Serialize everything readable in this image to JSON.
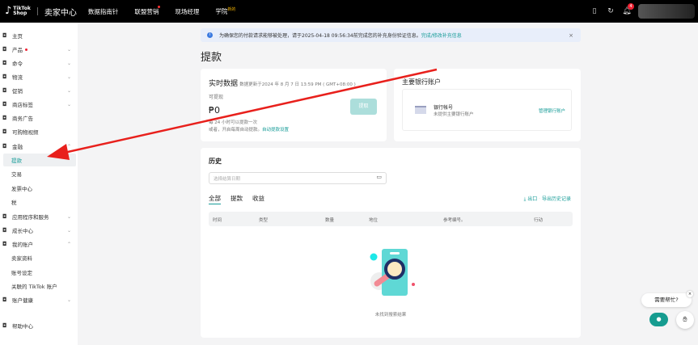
{
  "topbar": {
    "logo_line1": "TikTok",
    "logo_line2": "Shop",
    "brand": "卖家中心",
    "nav": [
      "数据指南针",
      "联盟营销",
      "现场经理",
      "学院"
    ],
    "new_badge": "新的",
    "notification_count": "4"
  },
  "sidebar": {
    "items": [
      {
        "label": "主页",
        "icon": "home-icon"
      },
      {
        "label": "产品",
        "icon": "product-icon",
        "dot": true,
        "chev": "⌄"
      },
      {
        "label": "命令",
        "icon": "order-icon",
        "chev": "⌄"
      },
      {
        "label": "物流",
        "icon": "truck-icon",
        "chev": "⌄"
      },
      {
        "label": "促销",
        "icon": "megaphone-icon",
        "chev": "⌄"
      },
      {
        "label": "商店标签",
        "icon": "bag-icon",
        "chev": "⌄"
      },
      {
        "label": "商务广告",
        "icon": "ad-icon"
      },
      {
        "label": "可购物视频",
        "icon": "video-icon"
      },
      {
        "label": "金融",
        "icon": "wallet-icon",
        "chev": "⌃"
      },
      {
        "label": "提款",
        "sub": true,
        "selected": true
      },
      {
        "label": "交易",
        "sub": true
      },
      {
        "label": "发票中心",
        "sub": true
      },
      {
        "label": "税",
        "sub": true
      },
      {
        "label": "应用程序和服务",
        "icon": "apps-icon",
        "chev": "⌄"
      },
      {
        "label": "成长中心",
        "icon": "growth-icon",
        "chev": "⌄"
      },
      {
        "label": "我的账户",
        "icon": "user-icon",
        "chev": "⌃"
      },
      {
        "label": "卖家资料",
        "sub": true
      },
      {
        "label": "账号设定",
        "sub": true
      },
      {
        "label": "关联的 TikTok 账户",
        "sub": true
      },
      {
        "label": "账户健康",
        "icon": "health-icon",
        "chev": "⌄"
      },
      {
        "label": "帮助中心",
        "icon": "help-icon"
      }
    ]
  },
  "banner": {
    "text": "为确保您的付款请求能够被处理，请于2025-04-18 09:56:34前完成您的补充身份验证信息。",
    "link": "完成/修改补充信息"
  },
  "page_title": "提款",
  "realtime": {
    "title": "实时数据",
    "updated": "数据更新于2024 年 8 月 7 日 13:59 PM ( GMT+08:00 )",
    "available_label": "可提现",
    "amount": "₱0",
    "withdraw_button": "提取",
    "note1": "每 24 小时可以提款一次",
    "note2": "或者，开启每周自动提款。",
    "note_link": "自动提款设置"
  },
  "bank": {
    "title": "主要银行账户",
    "account_label": "银行帐号",
    "account_desc": "未提供主要银行账户",
    "manage_link": "管理银行账户"
  },
  "history": {
    "title": "历史",
    "date_placeholder": "选择结算日期",
    "tabs": [
      "全部",
      "提款",
      "收益"
    ],
    "export": "出口",
    "export_history": "导出历史记录",
    "columns": [
      "时间",
      "类型",
      "数量",
      "地位",
      "参考编号。",
      "行动"
    ],
    "empty": "未找到搜索结果"
  },
  "help": {
    "bubble": "需要帮忙?"
  },
  "colors": {
    "accent": "#179c98",
    "annotation_arrow": "#e8201c"
  }
}
